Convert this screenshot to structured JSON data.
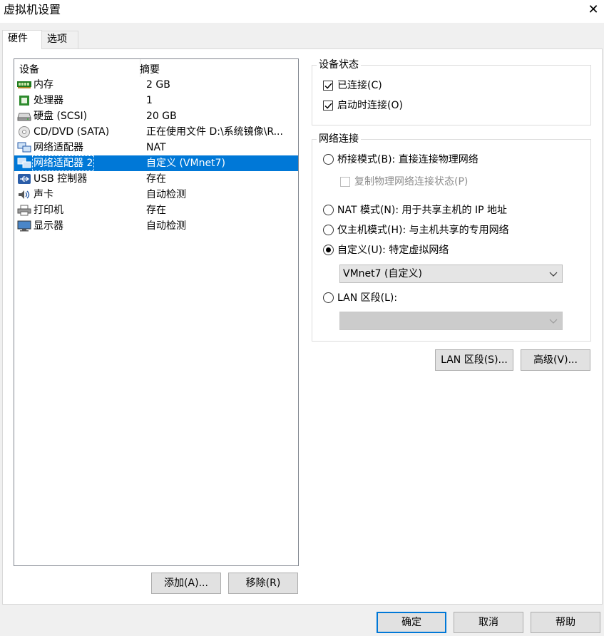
{
  "window": {
    "title": "虚拟机设置",
    "close_icon": "close-icon"
  },
  "tabs": [
    {
      "label": "硬件",
      "active": true
    },
    {
      "label": "选项",
      "active": false
    }
  ],
  "devices": {
    "columns": [
      "设备",
      "摘要"
    ],
    "rows": [
      {
        "name": "内存",
        "summary": "2 GB",
        "icon": "memory-icon"
      },
      {
        "name": "处理器",
        "summary": "1",
        "icon": "processor-icon"
      },
      {
        "name": "硬盘 (SCSI)",
        "summary": "20 GB",
        "icon": "hard-disk-icon"
      },
      {
        "name": "CD/DVD (SATA)",
        "summary": "正在使用文件 D:\\系统镜像\\R...",
        "icon": "cd-dvd-icon"
      },
      {
        "name": "网络适配器",
        "summary": "NAT",
        "icon": "network-adapter-icon"
      },
      {
        "name": "网络适配器 2",
        "summary": "自定义 (VMnet7)",
        "icon": "network-adapter-icon",
        "selected": true
      },
      {
        "name": "USB 控制器",
        "summary": "存在",
        "icon": "usb-icon"
      },
      {
        "name": "声卡",
        "summary": "自动检测",
        "icon": "sound-card-icon"
      },
      {
        "name": "打印机",
        "summary": "存在",
        "icon": "printer-icon"
      },
      {
        "name": "显示器",
        "summary": "自动检测",
        "icon": "display-icon"
      }
    ],
    "add_button": "添加(A)...",
    "remove_button": "移除(R)"
  },
  "device_status": {
    "label": "设备状态",
    "connected": {
      "label": "已连接(C)",
      "checked": true
    },
    "connect_at_power_on": {
      "label": "启动时连接(O)",
      "checked": true
    }
  },
  "network_connection": {
    "label": "网络连接",
    "bridged": {
      "label": "桥接模式(B): 直接连接物理网络",
      "selected": false
    },
    "replicate": {
      "label": "复制物理网络连接状态(P)",
      "checked": false,
      "enabled": false
    },
    "nat": {
      "label": "NAT 模式(N): 用于共享主机的 IP 地址",
      "selected": false
    },
    "host_only": {
      "label": "仅主机模式(H): 与主机共享的专用网络",
      "selected": false
    },
    "custom": {
      "label": "自定义(U): 特定虚拟网络",
      "selected": true
    },
    "custom_select_value": "VMnet7 (自定义)",
    "lan_segment": {
      "label": "LAN 区段(L):",
      "selected": false
    },
    "lan_select_value": ""
  },
  "buttons": {
    "lan_segments": "LAN 区段(S)...",
    "advanced": "高级(V)...",
    "ok": "确定",
    "cancel": "取消",
    "help": "帮助"
  }
}
